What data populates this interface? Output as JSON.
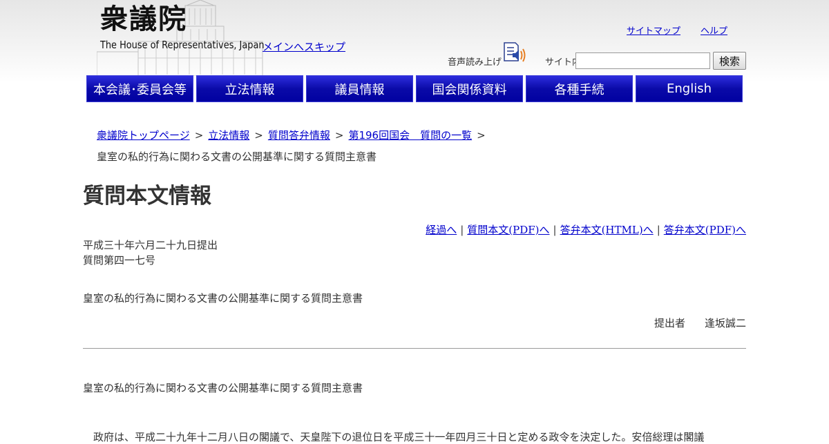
{
  "header": {
    "logo_kanji": "衆議院",
    "logo_en": "The House of Representatives, Japan",
    "skip_link": "メインへスキップ",
    "top_links": [
      "サイトマップ",
      "ヘルプ"
    ],
    "speech_label": "音声読み上げ",
    "speech_icon": "speaker-icon",
    "search_label": "サイト内検索",
    "search_value": "",
    "search_button": "検索"
  },
  "nav": {
    "items": [
      "本会議･委員会等",
      "立法情報",
      "議員情報",
      "国会関係資料",
      "各種手続",
      "English"
    ],
    "colors": {
      "top": "#2f2fe0",
      "bottom": "#0000a0",
      "text": "#ffffff"
    }
  },
  "breadcrumb": {
    "items": [
      "衆議院トップページ",
      "立法情報",
      "質問答弁情報",
      "第196回国会　質問の一覧"
    ],
    "separator": ">",
    "current": "皇室の私的行為に関わる文書の公開基準に関する質問主意書"
  },
  "page_title": "質問本文情報",
  "doc_links": [
    "経過へ",
    "質問本文(PDF)へ",
    "答弁本文(HTML)へ",
    "答弁本文(PDF)へ"
  ],
  "doc_links_separator": "|",
  "document": {
    "date": "平成三十年六月二十九日提出",
    "number": "質問第四一七号",
    "title": "皇室の私的行為に関わる文書の公開基準に関する質問主意書",
    "submitter_label": "提出者",
    "submitter_name": "逢坂誠二",
    "body_title": "皇室の私的行為に関わる文書の公開基準に関する質問主意書",
    "body_first_line": "　政府は、平成二十九年十二月八日の閣議で、天皇陛下の退位日を平成三十一年四月三十日と定める政令を決定した。安倍総理は閣議"
  },
  "colors": {
    "link": "#0000cc",
    "text": "#333333",
    "rule": "#999999"
  }
}
